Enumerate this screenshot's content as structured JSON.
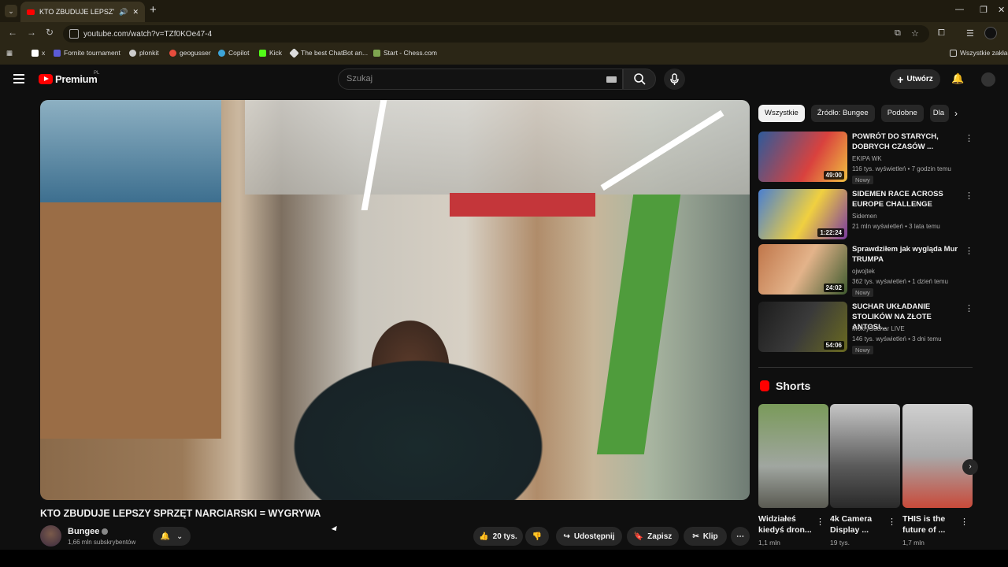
{
  "browser": {
    "tab_title": "KTO ZBUDUJE LEPSZY SPRZĘ",
    "url": "youtube.com/watch?v=TZf0KOe47-4",
    "bookmarks": [
      "x",
      "Fornite tournament",
      "plonkit",
      "geogusser",
      "Copilot",
      "Kick",
      "The best ChatBot an...",
      "Start - Chess.com"
    ],
    "bookmarks_all": "Wszystkie zakład"
  },
  "header": {
    "logo": "Premium",
    "region": "PL",
    "search_placeholder": "Szukaj",
    "create_label": "Utwórz"
  },
  "video": {
    "title": "KTO ZBUDUJE LEPSZY SPRZĘT NARCIARSKI = WYGRYWA",
    "channel": "Bungee",
    "subscribers": "1,66 mln subskrybentów",
    "likes": "20 tys.",
    "share": "Udostępnij",
    "save": "Zapisz",
    "clip": "Klip"
  },
  "chips": [
    "Wszystkie",
    "Źródło: Bungee",
    "Podobne",
    "Dla"
  ],
  "recommendations": [
    {
      "title": "POWRÓT DO STARYCH, DOBRYCH CZASÓW ...",
      "channel": "EKIPA WK",
      "meta": "116 tys. wyświetleń • 7 godzin temu",
      "badge": "Nowy",
      "duration": "49:00"
    },
    {
      "title": "SIDEMEN RACE ACROSS EUROPE CHALLENGE",
      "channel": "Sidemen",
      "meta": "21 mln wyświetleń • 3 lata temu",
      "badge": "",
      "duration": "1:22:24"
    },
    {
      "title": "Sprawdziłem jak wygląda Mur TRUMPA",
      "channel": "ojwojtek",
      "meta": "362 tys. wyświetleń • 1 dzień temu",
      "badge": "Nowy",
      "duration": "24:02"
    },
    {
      "title": "SUCHAR UKŁADANIE STOLIKÓW NA ZŁOTE ANTOSI...",
      "channel": "MokrySuchar LIVE",
      "meta": "146 tys. wyświetleń • 3 dni temu",
      "badge": "Nowy",
      "duration": "54:06"
    }
  ],
  "shorts": {
    "heading": "Shorts",
    "items": [
      {
        "title": "Widziałeś kiedyś dron...",
        "views": "1,1 mln"
      },
      {
        "title": "4k Camera Display ...",
        "views": "19 tys."
      },
      {
        "title": "THIS is the future of ...",
        "views": "1,7 mln"
      }
    ]
  }
}
